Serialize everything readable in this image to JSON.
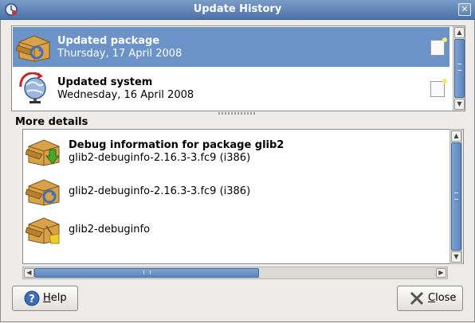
{
  "window": {
    "title": "Update History",
    "app_icon": "update-history-icon",
    "close_icon": "close-icon"
  },
  "history": {
    "items": [
      {
        "title": "Updated package",
        "date": "Thursday, 17 April 2008",
        "icon": "package-update-icon",
        "selected": true,
        "note_icon": "note-icon"
      },
      {
        "title": "Updated system",
        "date": "Wednesday, 16 April 2008",
        "icon": "system-update-icon",
        "selected": false,
        "note_icon": "note-icon"
      }
    ]
  },
  "details": {
    "label": "More details",
    "items": [
      {
        "title": "Debug information for package glib2",
        "subtitle": "glib2-debuginfo-2.16.3-3.fc9 (i386)",
        "icon": "package-install-icon"
      },
      {
        "title": "",
        "subtitle": "glib2-debuginfo-2.16.3-3.fc9 (i386)",
        "icon": "package-update-icon"
      },
      {
        "title": "",
        "subtitle": "glib2-debuginfo",
        "icon": "package-clean-icon"
      }
    ]
  },
  "buttons": {
    "help": {
      "mnemonic": "H",
      "rest": "elp",
      "icon": "help-icon"
    },
    "close": {
      "mnemonic": "C",
      "rest": "lose",
      "icon": "close-x-icon"
    }
  },
  "colors": {
    "selection": "#6b93c8",
    "titlebar": "#4d72a8"
  }
}
